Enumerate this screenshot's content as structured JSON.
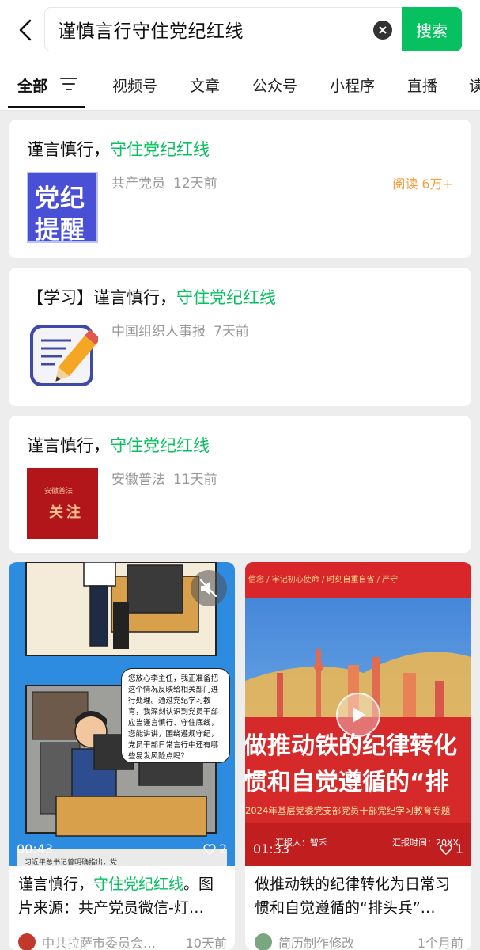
{
  "search": {
    "query": "谨慎言行守住党纪红线",
    "button_label": "搜索"
  },
  "tabs": [
    {
      "label": "全部",
      "active": true
    },
    {
      "label": "视频号"
    },
    {
      "label": "文章"
    },
    {
      "label": "公众号"
    },
    {
      "label": "小程序"
    },
    {
      "label": "直播"
    },
    {
      "label": "读"
    }
  ],
  "results": [
    {
      "title_prefix": "谨言慎行，",
      "title_highlight": "守住党纪红线",
      "thumb_text_1": "党纪",
      "thumb_text_2": "提醒",
      "source": "共产党员",
      "time": "12天前",
      "reads": "阅读 6万+"
    },
    {
      "title_prefix": "【学习】谨言慎行，",
      "title_highlight": "守住党纪红线",
      "source": "中国组织人事报",
      "time": "7天前"
    },
    {
      "title_prefix": "谨言慎行，",
      "title_highlight": "守住党纪红线",
      "thumb_text_1": "安徽普法",
      "thumb_text_2": "关注",
      "source": "安徽普法",
      "time": "11天前"
    }
  ],
  "videos": [
    {
      "duration": "00:43",
      "likes": "2",
      "title_prefix": "谨言慎行，",
      "title_highlight": "守住党纪红线",
      "title_suffix": "。图片来源：共产党员微信-灯…",
      "bubble_text": "您放心李主任，我正准备把这个情况反映给相关部门进行处理。通过党纪学习教育，我深刻认识到党员干部应当谨言慎行、守住底线，您能讲讲，围绕遵规守纪，党员干部日常言行中还有哪些易发风险点吗？",
      "caption": "习近平总书记曾明确指出，党",
      "source": "中共拉萨市委员会…",
      "time": "10天前",
      "avatar_color": "#c0392b"
    },
    {
      "duration": "01:33",
      "likes": "1",
      "title_prefix": "做推动铁的纪律转化为日常习惯和自觉遵循的“排头兵”…",
      "poster_top": "信念 / 牢记初心使命 / 时刻自重自省 / 严守",
      "poster_big_1": "做推动铁的纪律转化",
      "poster_big_2": "惯和自觉遵循的“排",
      "poster_sub": "2024年基层党委党支部党员干部党纪学习教育专题",
      "reporter": "汇报人：智禾",
      "report_time": "汇报时间：20XX",
      "source": "简历制作修改",
      "time": "1个月前",
      "avatar_color": "#7aa77f"
    }
  ],
  "colors": {
    "accent": "#07c160",
    "reads": "#fa9d3b"
  }
}
